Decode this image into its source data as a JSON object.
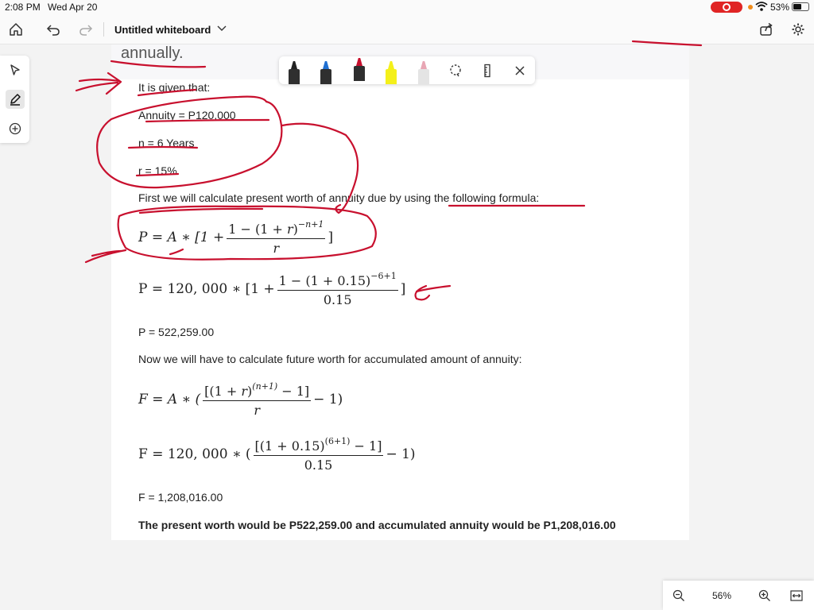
{
  "status": {
    "time": "2:08 PM",
    "date": "Wed Apr 20",
    "battery": "53%"
  },
  "toolbar": {
    "title": "Untitled whiteboard",
    "icons": [
      "home-icon",
      "undo-icon",
      "redo-icon",
      "chevron-down-icon",
      "share-icon",
      "gear-icon"
    ]
  },
  "left_tools": [
    "select-arrow-icon",
    "pen-icon",
    "add-icon"
  ],
  "palette": {
    "pens": [
      {
        "name": "black-pen",
        "color": "#222222"
      },
      {
        "name": "blue-pen",
        "color": "#1f6fd1"
      },
      {
        "name": "red-pen",
        "color": "#c8102e"
      },
      {
        "name": "yellow-highlighter",
        "color": "#f4f01a"
      },
      {
        "name": "eraser",
        "color": "#e8a6b4"
      }
    ],
    "icons": [
      "lasso-icon",
      "ruler-icon",
      "close-icon"
    ]
  },
  "content": {
    "heading": "annually.",
    "given_intro": "It is given that:",
    "annuity": "Annuity = P120,000",
    "n_value": "n = 6 Years",
    "r_value": "r = 15%",
    "first_step": "First we will calculate present worth of annuity due by using the following formula:",
    "p_formula": {
      "lhs": "P = A ∗ [1 +",
      "numerator_a": "1 − (1 + ",
      "numerator_var": "r",
      "numerator_b": ")",
      "exponent": "−n+1",
      "denominator": "r",
      "close": "]"
    },
    "p_calc": {
      "lhs": "P = 120, 000 ∗ [1 +",
      "numerator": "1 − (1 + 0.15)",
      "exponent": "−6+1",
      "denominator": "0.15",
      "close": "]"
    },
    "p_result": "P = 522,259.00",
    "second_step": "Now we will have to calculate future worth for accumulated amount of annuity:",
    "f_formula": {
      "lhs": "F = A ∗ (",
      "numerator_a": "[(1 + ",
      "numerator_var": "r",
      "numerator_b": ")",
      "exponent": "(n+1)",
      "numerator_c": " − 1]",
      "denominator": "r",
      "close": "− 1)"
    },
    "f_calc": {
      "lhs": "F = 120, 000 ∗ (",
      "numerator": "[(1 + 0.15)",
      "exponent": "(6+1)",
      "numerator_c": " − 1]",
      "denominator": "0.15",
      "close": "− 1)"
    },
    "f_result": "F = 1,208,016.00",
    "conclusion": "The present worth would be P522,259.00 and accumulated annuity would be P1,208,016.00"
  },
  "zoom": {
    "level": "56%"
  },
  "colors": {
    "ink": "#c8102e",
    "accent_red": "#e02424"
  }
}
